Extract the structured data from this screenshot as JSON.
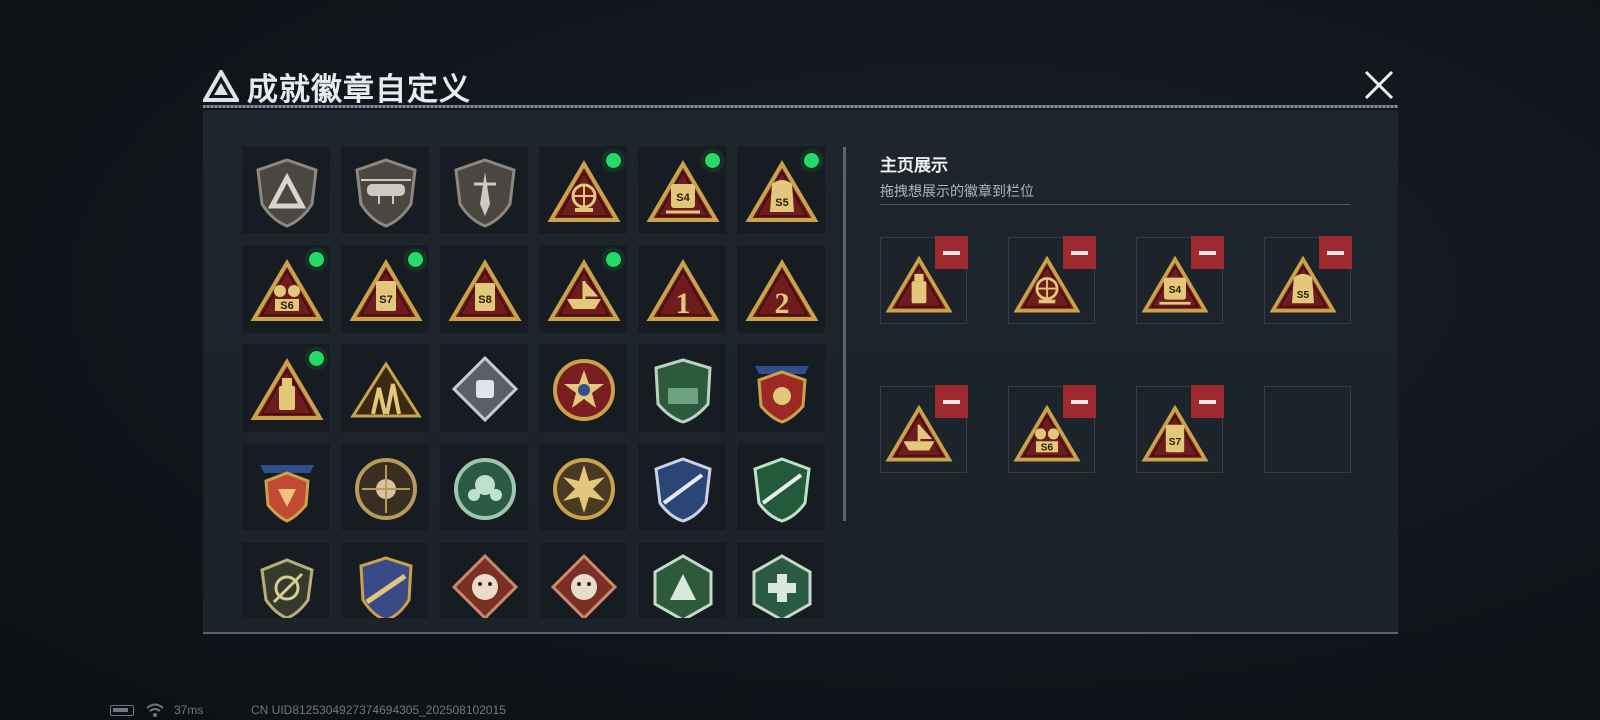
{
  "window": {
    "title": "成就徽章自定义"
  },
  "showcase": {
    "title": "主页展示",
    "subtitle": "拖拽想展示的徽章到栏位",
    "slots": [
      {
        "icon": "tri-bottle-badge",
        "filled": true
      },
      {
        "icon": "tri-globe-badge",
        "filled": true
      },
      {
        "icon": "tri-s4-badge",
        "filled": true
      },
      {
        "icon": "tri-s5-badge",
        "filled": true
      },
      {
        "icon": "tri-ship-badge",
        "filled": true
      },
      {
        "icon": "tri-s6-badge",
        "filled": true
      },
      {
        "icon": "tri-s7-badge",
        "filled": true
      },
      {
        "icon": "empty-slot",
        "filled": false
      }
    ]
  },
  "badges": [
    {
      "icon": "shield-logo-badge",
      "new": false
    },
    {
      "icon": "shield-helicopter-badge",
      "new": false
    },
    {
      "icon": "shield-dagger-badge",
      "new": false
    },
    {
      "icon": "tri-globe-badge",
      "new": true
    },
    {
      "icon": "tri-s4-badge",
      "new": true
    },
    {
      "icon": "tri-s5-badge",
      "new": true
    },
    {
      "icon": "tri-s6-badge",
      "new": true
    },
    {
      "icon": "tri-s7-badge",
      "new": true
    },
    {
      "icon": "tri-s8-badge",
      "new": false
    },
    {
      "icon": "tri-ship-badge",
      "new": true
    },
    {
      "icon": "tri-number-1-badge",
      "new": false
    },
    {
      "icon": "tri-number-2-badge",
      "new": false
    },
    {
      "icon": "tri-bottle-badge",
      "new": true
    },
    {
      "icon": "tri-soldiers-badge",
      "new": false
    },
    {
      "icon": "diamond-fist-badge",
      "new": false
    },
    {
      "icon": "star-medal-badge",
      "new": false
    },
    {
      "icon": "green-shield-badge",
      "new": false
    },
    {
      "icon": "winged-shield-badge",
      "new": false
    },
    {
      "icon": "red-crest-badge",
      "new": false
    },
    {
      "icon": "skull-scope-badge",
      "new": false
    },
    {
      "icon": "green-boxer-badge",
      "new": false
    },
    {
      "icon": "tank-burst-badge",
      "new": false
    },
    {
      "icon": "blue-rifle-badge",
      "new": false
    },
    {
      "icon": "green-rifle-badge",
      "new": false
    },
    {
      "icon": "scope-shield-badge",
      "new": false
    },
    {
      "icon": "blue-eagle-badge",
      "new": false
    },
    {
      "icon": "tiger-diamond-badge",
      "new": false
    },
    {
      "icon": "tiger-diamond-badge",
      "new": false
    },
    {
      "icon": "green-soldier-badge",
      "new": false
    },
    {
      "icon": "green-medic-badge",
      "new": false
    }
  ],
  "status_bar": {
    "ping": "37ms",
    "uid": "CN UID8125304927374694305_202508102015"
  },
  "colors": {
    "accent_green": "#27d96b",
    "remove_red": "#9e2a2f",
    "badge_gold": "#c9a24a",
    "badge_red": "#6f1c1c"
  }
}
